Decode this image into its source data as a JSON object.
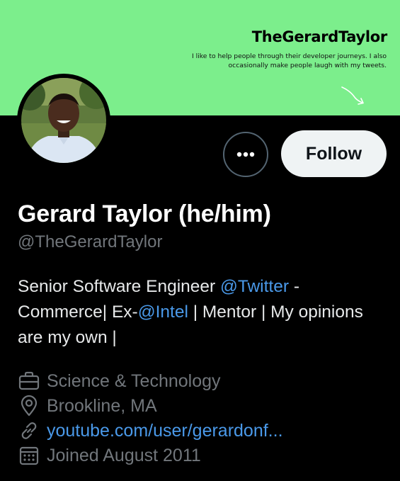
{
  "banner": {
    "title": "TheGerardTaylor",
    "tagline_line1": "I like to help people through their developer journeys. I also",
    "tagline_line2": "occasionally make people laugh with my tweets.",
    "background_color": "#7cee8c"
  },
  "profile": {
    "display_name": "Gerard Taylor (he/him)",
    "handle": "@TheGerardTaylor",
    "avatar_icon": "profile-photo"
  },
  "actions": {
    "more_icon": "ellipsis-icon",
    "follow_label": "Follow"
  },
  "bio": {
    "text1": "Senior Software Engineer ",
    "mention1": "@Twitter",
    "text2": " - Commerce| Ex-",
    "mention2": "@Intel",
    "text3": " | Mentor | My opinions are my own |"
  },
  "meta": {
    "category": "Science & Technology",
    "location": "Brookline, MA",
    "website": "youtube.com/user/gerardonf...",
    "joined": "Joined August 2011"
  },
  "colors": {
    "link": "#4a99e9",
    "secondary_text": "#71767b",
    "background": "#000000"
  }
}
